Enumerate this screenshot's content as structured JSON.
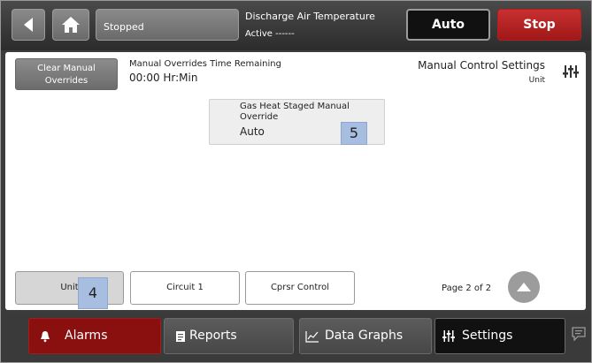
{
  "topbar": {
    "status": "Stopped",
    "dat_title": "Discharge Air Temperature",
    "dat_status": "Active ------",
    "auto_label": "Auto",
    "stop_label": "Stop"
  },
  "content": {
    "clear_button": "Clear Manual Overrides",
    "override_title": "Manual Overrides Time Remaining",
    "override_time": "00:00 Hr:Min",
    "settings_title": "Manual Control Settings",
    "settings_sub": "Unit",
    "gas_card": {
      "label": "Gas Heat Staged Manual Override",
      "value": "Auto",
      "badge": "5"
    },
    "tabs": [
      {
        "label": "Unit",
        "active": true
      },
      {
        "label": "Circuit 1",
        "active": false
      },
      {
        "label": "Cprsr Control",
        "active": false
      }
    ],
    "unit_badge": "4",
    "page_label": "Page 2 of 2"
  },
  "bottombar": {
    "alarms": "Alarms",
    "reports": "Reports",
    "graphs": "Data Graphs",
    "settings": "Settings"
  },
  "icons": [
    "back-icon",
    "home-icon",
    "settings-sliders-icon",
    "arrow-up-icon",
    "bell-icon",
    "report-icon",
    "graph-icon",
    "chat-icon"
  ]
}
